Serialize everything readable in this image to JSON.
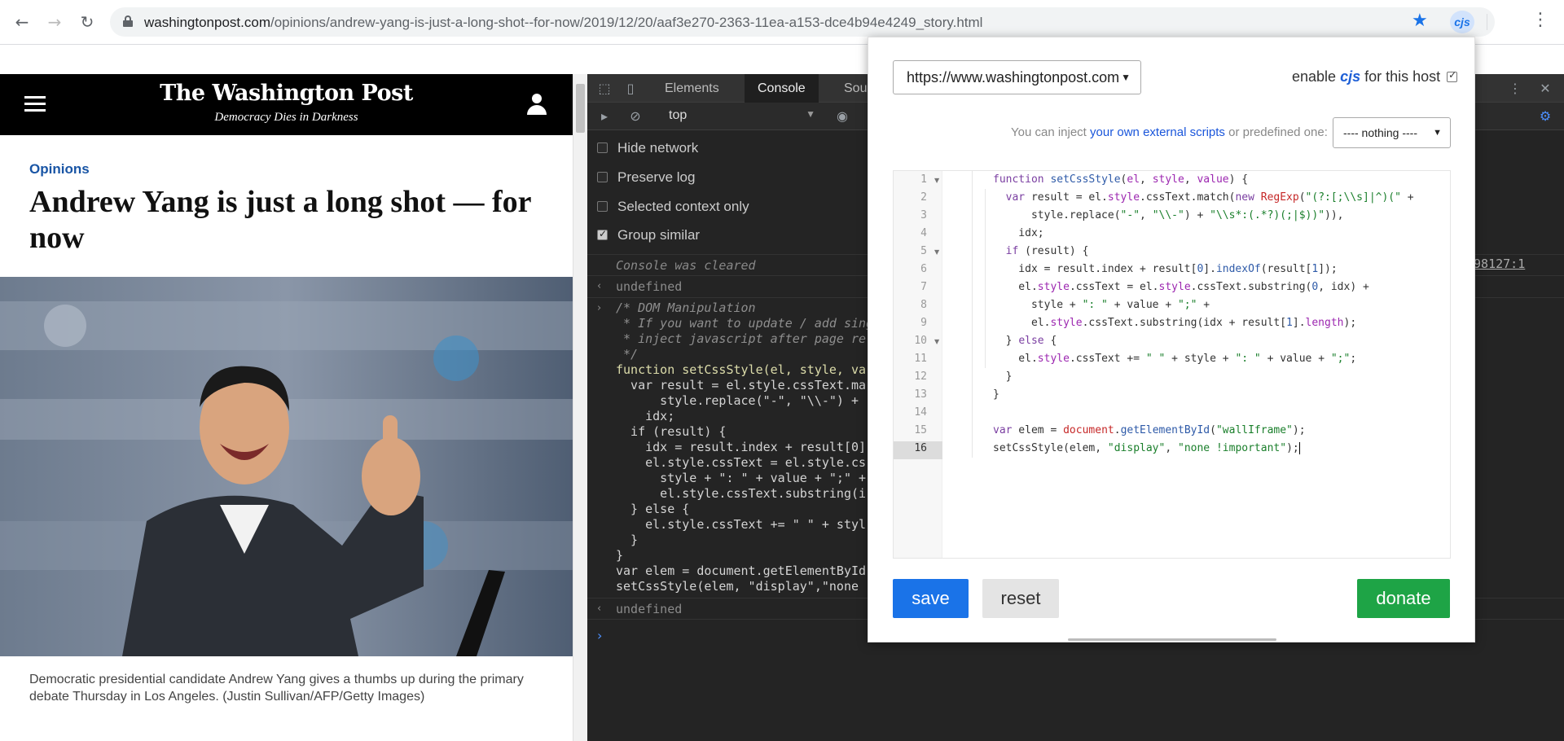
{
  "browser": {
    "url_host": "washingtonpost.com",
    "url_path": "/opinions/andrew-yang-is-just-a-long-shot--for-now/2019/12/20/aaf3e270-2363-11ea-a153-dce4b94e4249_story.html",
    "extension_label": "cjs"
  },
  "article": {
    "masthead": "The Washington Post",
    "tagline": "Democracy Dies in Darkness",
    "kicker": "Opinions",
    "headline": "Andrew Yang is just a long shot — for now",
    "caption": "Democratic presidential candidate Andrew Yang gives a thumbs up during the primary debate Thursday in Los Angeles. (Justin Sullivan/AFP/Getty Images)"
  },
  "devtools": {
    "tabs": [
      "Elements",
      "Console",
      "Sourc"
    ],
    "active_tab": "Console",
    "context": "top",
    "options": [
      {
        "label": "Hide network",
        "checked": false
      },
      {
        "label": "Preserve log",
        "checked": false
      },
      {
        "label": "Selected context only",
        "checked": false
      },
      {
        "label": "Group similar",
        "checked": true
      }
    ],
    "cleared": "Console was cleared",
    "undefined1": "undefined",
    "undefined2": "undefined",
    "source_link": "M98127:1",
    "code": [
      "/* DOM Manipulation",
      " * If you want to update / add sing",
      " * inject javascript after page rel",
      " */",
      "function setCssStyle(el, style, va",
      "  var result = el.style.cssText.ma",
      "      style.replace(\"-\", \"\\\\-\") +",
      "    idx;",
      "  if (result) {",
      "    idx = result.index + result[0]",
      "    el.style.cssText = el.style.cs",
      "      style + \": \" + value + \";\" +",
      "      el.style.cssText.substring(i",
      "  } else {",
      "    el.style.cssText += \" \" + styl",
      "  }",
      "}",
      "var elem = document.getElementById",
      "setCssStyle(elem, \"display\",\"none"
    ]
  },
  "popup": {
    "host_option": "https://www.washingtonpost.com",
    "enable_prefix": "enable ",
    "enable_cjs": "cjs",
    "enable_suffix": " for this host",
    "inject_prefix": "You can inject ",
    "inject_link": "your own external scripts",
    "inject_suffix": " or predefined one:",
    "predefined_option": "---- nothing ----",
    "save_label": "save",
    "reset_label": "reset",
    "donate_label": "donate",
    "editor_line_count": 16,
    "editor_active_line": 16
  },
  "colors": {
    "save": "#1a73e8",
    "donate": "#1ea446",
    "devtools_bg": "#242424",
    "wp_header": "#000000"
  }
}
